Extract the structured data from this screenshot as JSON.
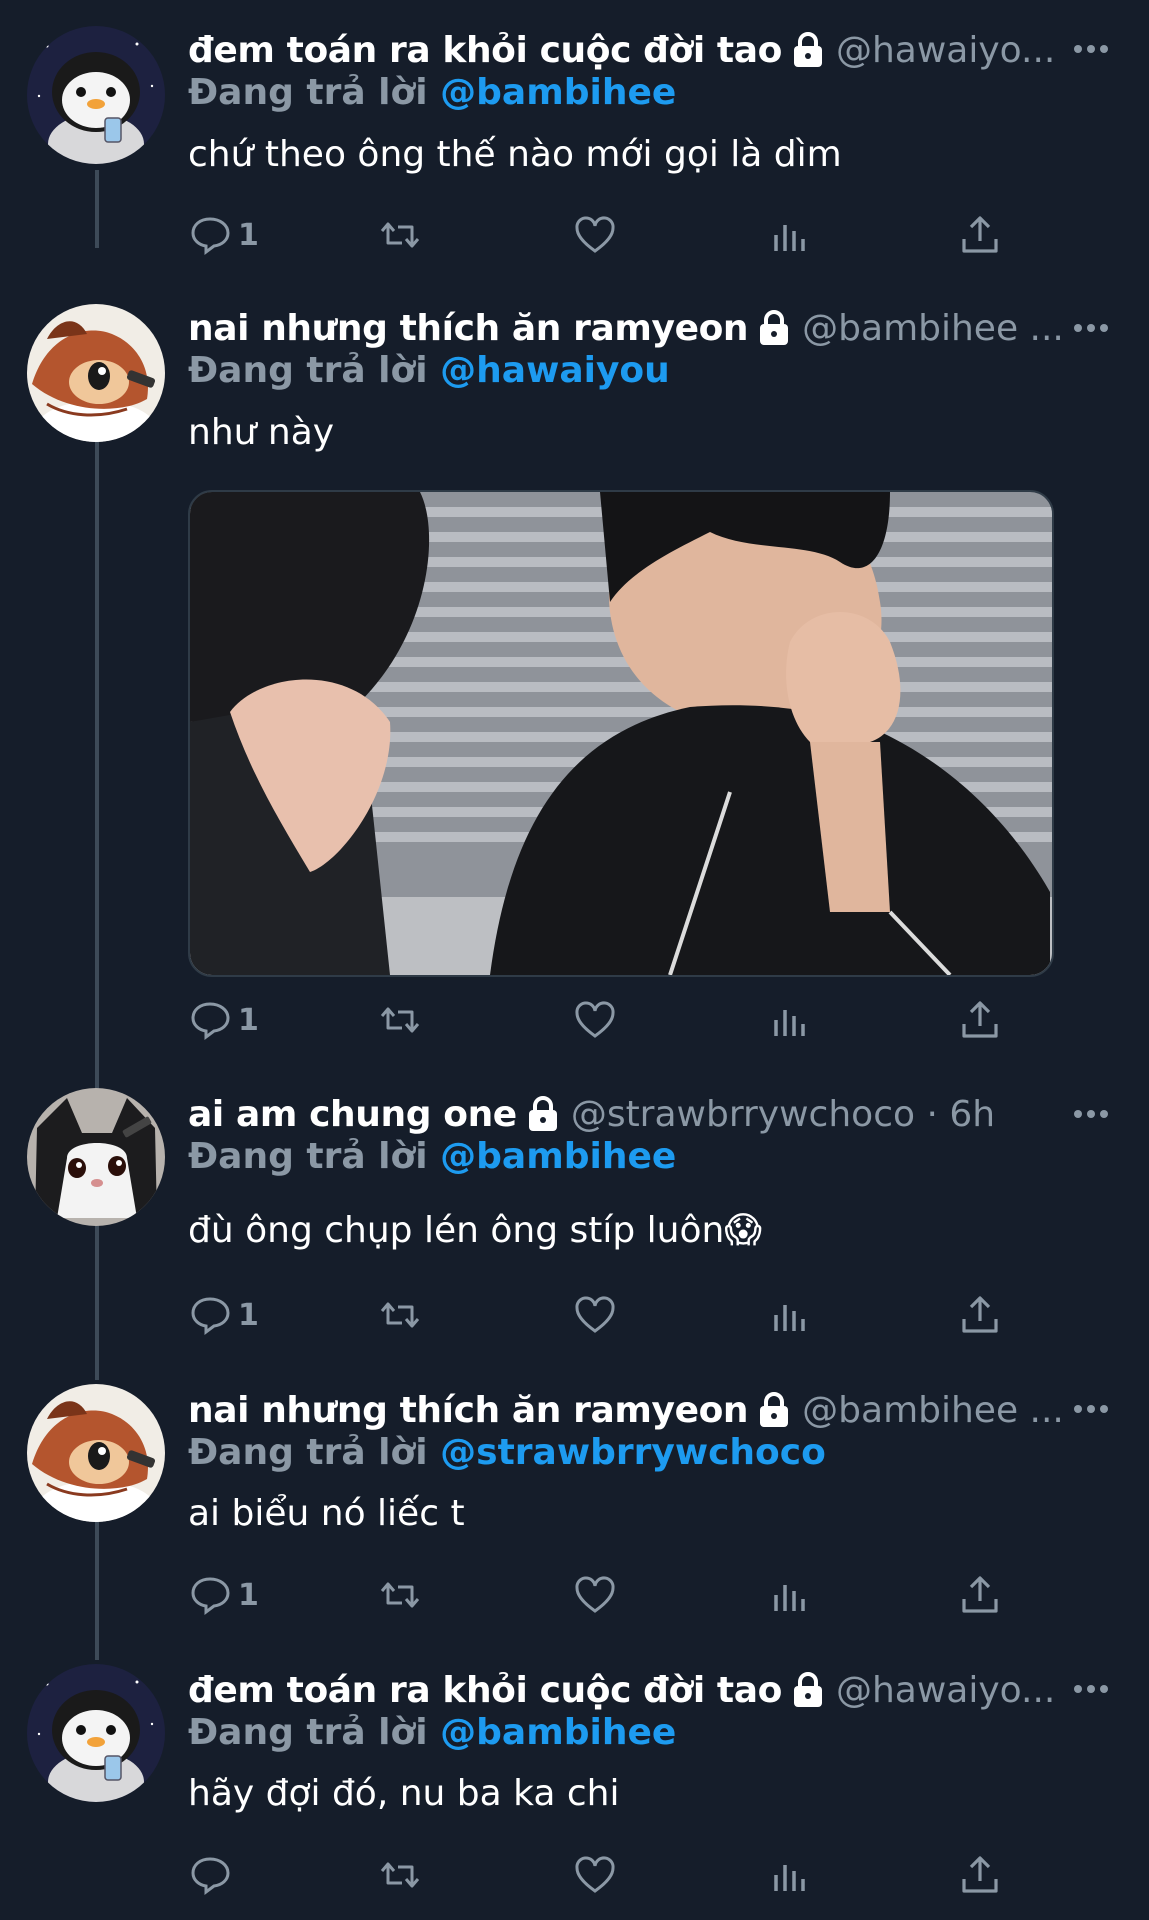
{
  "reply_prefix": "Đang trả lời",
  "tweets": [
    {
      "name": "đem toán ra khỏi cuộc đời tao",
      "handle": "@hawaiyo...",
      "replying_to": "@bambihee",
      "text": "chứ theo ông thế nào mới gọi là dìm",
      "reply_count": "1",
      "avatar": "penguin-avatar"
    },
    {
      "name": "nai nhưng thích ăn ramyeon",
      "handle": "@bambihee ...",
      "replying_to": "@hawaiyou",
      "text": "như này",
      "reply_count": "1",
      "avatar": "deer-avatar",
      "has_media": true
    },
    {
      "name": "ai am chung one",
      "handle": "@strawbrrywchoco · 6h",
      "replying_to": "@bambihee",
      "text": "đù ông chụp lén ông stíp luôn😱",
      "reply_count": "1",
      "avatar": "cat-avatar"
    },
    {
      "name": "nai nhưng thích ăn ramyeon",
      "handle": "@bambihee ...",
      "replying_to": "@strawbrrywchoco",
      "text": "ai biểu nó liếc t",
      "reply_count": "1",
      "avatar": "deer-avatar"
    },
    {
      "name": "đem toán ra khỏi cuộc đời tao",
      "handle": "@hawaiyo...",
      "replying_to": "@bambihee",
      "text": "hãy đợi đó, nu ba ka chi",
      "reply_count": "",
      "avatar": "penguin-avatar"
    }
  ],
  "colors": {
    "background": "#151d2a",
    "mention": "#1d9bf0",
    "muted": "#8b98a5"
  }
}
